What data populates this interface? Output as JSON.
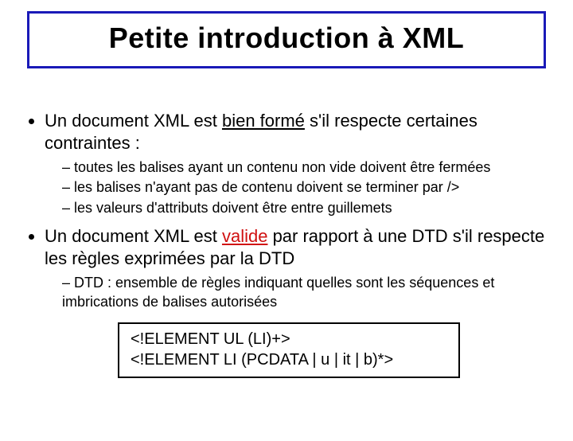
{
  "title": "Petite  introduction à XML",
  "bullet1": {
    "pre": "Un document  XML est ",
    "u": "bien formé",
    "post": " s'il respecte certaines contraintes :",
    "sub1": "toutes les balises ayant un contenu non vide doivent être fermées",
    "sub2": "les  balises n'ayant pas de contenu doivent se terminer par />",
    "sub3": "les  valeurs d'attributs doivent être entre guillemets"
  },
  "bullet2": {
    "pre": "Un document  XML est ",
    "u": "valide",
    "post": " par rapport à une DTD s'il respecte les règles exprimées par la DTD",
    "sub1": "DTD : ensemble de règles indiquant quelles sont les  séquences et imbrications de balises autorisées"
  },
  "code": {
    "line1": "<!ELEMENT UL (LI)+>",
    "line2": "<!ELEMENT LI (PCDATA | u | it | b)*>"
  }
}
